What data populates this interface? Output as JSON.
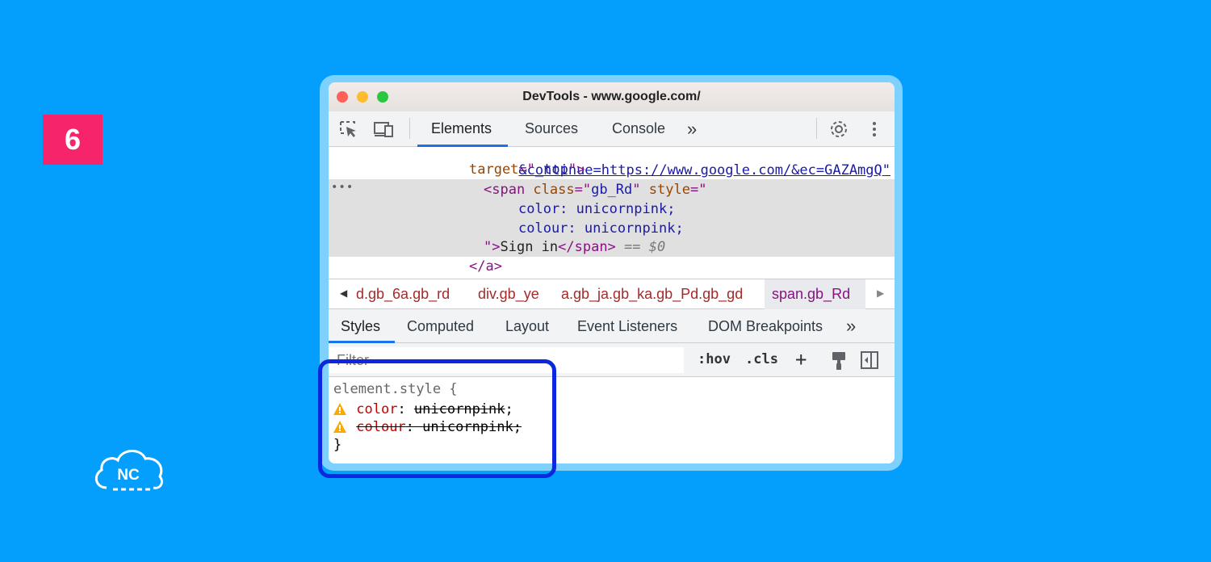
{
  "step_badge": "6",
  "logo": {
    "text": "NC"
  },
  "window": {
    "title": "DevTools - www.google.com/"
  },
  "toolbar": {
    "tabs": [
      "Elements",
      "Sources",
      "Console"
    ],
    "more": "»",
    "active_tab": "Elements"
  },
  "dom": {
    "line1_link": "&continue=https://www.google.com/&ec=GAZAmgQ\"",
    "line2_attr": "target",
    "line2_eq": "=\"",
    "line2_val": "_top",
    "line2_end": "\">",
    "line3_open": "<span ",
    "line3_attr1": "class",
    "line3_val1": "gb_Rd",
    "line3_attr2": "style",
    "line4": "color: unicornpink;",
    "line5": "colour: unicornpink;",
    "line6_close": "\">",
    "line6_text": "Sign in",
    "line6_endtag": "</span>",
    "line6_eq": " == ",
    "line6_dollar": "$0",
    "line7": "</a>",
    "ellipsis": "•••"
  },
  "breadcrumbs": [
    "d.gb_6a.gb_rd",
    "div.gb_ye",
    "a.gb_ja.gb_ka.gb_Pd.gb_gd",
    "span.gb_Rd"
  ],
  "styles_tabs": [
    "Styles",
    "Computed",
    "Layout",
    "Event Listeners",
    "DOM Breakpoints"
  ],
  "styles_more": "»",
  "filter": {
    "placeholder": "Filter",
    "hov": ":hov",
    "cls": ".cls",
    "add": "+"
  },
  "rules": {
    "selector": "element.style {",
    "decl1_prop": "color",
    "decl1_value": "unicornpink",
    "decl2_prop": "colour",
    "decl2_value": "unicornpink",
    "close": "}"
  },
  "colors": {
    "background": "#049ffd",
    "badge": "#f5246b",
    "focus_ring": "#0b27e0",
    "accent": "#1a73e8"
  }
}
